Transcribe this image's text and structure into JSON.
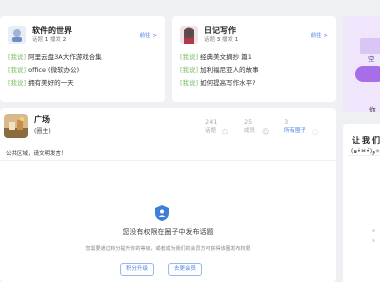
{
  "circles": [
    {
      "title": "软件的世界",
      "stats": {
        "topics_label": "话题",
        "topics": "1",
        "posts_label": "播发",
        "posts": "2"
      },
      "visit": "前往 >",
      "items": [
        {
          "tag": "[我说]",
          "text": "阿里云盘3A大作游戏合集"
        },
        {
          "tag": "[我说]",
          "text": "office (微软办公)"
        },
        {
          "tag": "[我说]",
          "text": "拥有美好的一天"
        }
      ]
    },
    {
      "title": "日记写作",
      "stats": {
        "topics_label": "话题",
        "topics": "3",
        "posts_label": "播发",
        "posts": "1"
      },
      "visit": "前往 >",
      "items": [
        {
          "tag": "[我说]",
          "text": "经典美文摘抄 篇1"
        },
        {
          "tag": "[我说]",
          "text": "加利福尼亚人的故事"
        },
        {
          "tag": "[我说]",
          "text": "如何提高写作水平?"
        }
      ]
    }
  ],
  "promo": {
    "line1": "空",
    "line2": "你"
  },
  "plaza": {
    "name": "广场",
    "sub": "(圈主)",
    "stats": [
      {
        "num": "241",
        "label": "话题"
      },
      {
        "num": "25",
        "label": "成员"
      },
      {
        "num": "3",
        "label": "所有圈子"
      }
    ],
    "notice": "公共区域，请文明发言！",
    "no_permission": "您没有权限在圈子中发布话题",
    "permission_desc": "您需要通过积分提升你的等级，或者成为我们的会员方可获得该圈发布权限",
    "btn_points": "积分升级",
    "btn_vip": "去更会员"
  },
  "rank": {
    "title": "让我们",
    "kaomoji": "(๑•̀ㅂ•́)و✧"
  },
  "colors": {
    "accent": "#4a7ee6",
    "tag_green": "#7cbf6a",
    "purple": "#a76ee8"
  }
}
